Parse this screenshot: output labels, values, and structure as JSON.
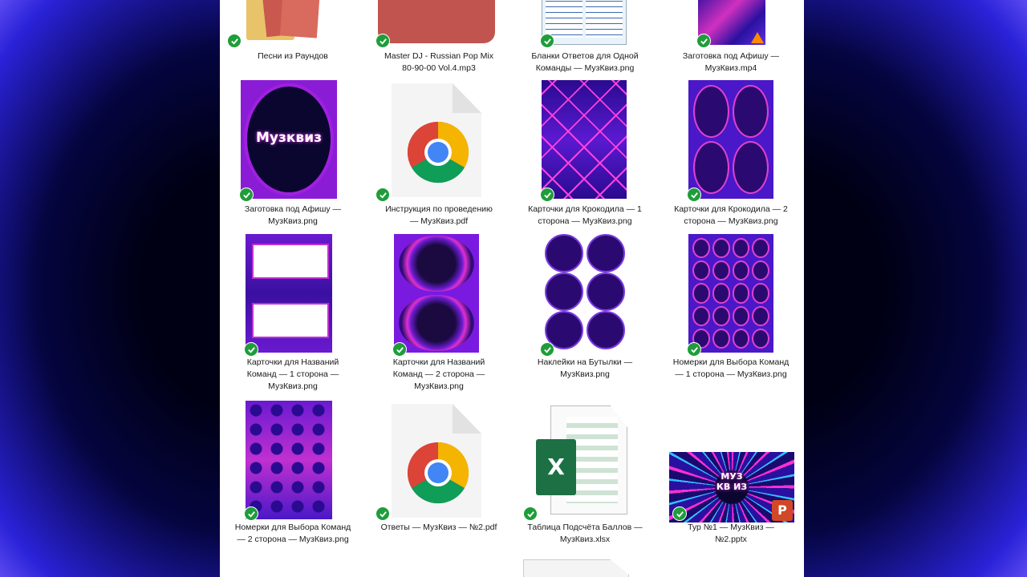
{
  "files": [
    {
      "name": "Песни из Раундов",
      "icon": "folder-icon"
    },
    {
      "name": "Master DJ - Russian Pop Mix\n80-90-00 Vol.4.mp3",
      "icon": "mp3-file-icon"
    },
    {
      "name": "Бланки Ответов для Одной\nКоманды — МузКвиз.png",
      "icon": "image-thumbnail"
    },
    {
      "name": "Заготовка под Афишу —\nМузКвиз.mp4",
      "icon": "video-thumbnail"
    },
    {
      "name": "Заготовка под Афишу —\nМузКвиз.png",
      "icon": "image-thumbnail"
    },
    {
      "name": "Инструкция по проведению\n— МузКвиз.pdf",
      "icon": "chrome-pdf-icon"
    },
    {
      "name": "Карточки для Крокодила — 1\nсторона — МузКвиз.png",
      "icon": "image-thumbnail"
    },
    {
      "name": "Карточки для Крокодила — 2\nсторона — МузКвиз.png",
      "icon": "image-thumbnail"
    },
    {
      "name": "Карточки для Названий\nКоманд — 1 сторона —\nМузКвиз.png",
      "icon": "image-thumbnail"
    },
    {
      "name": "Карточки для Названий\nКоманд — 2 сторона —\nМузКвиз.png",
      "icon": "image-thumbnail"
    },
    {
      "name": "Наклейки на Бутылки —\nМузКвиз.png",
      "icon": "image-thumbnail"
    },
    {
      "name": "Номерки для Выбора Команд\n— 1 сторона — МузКвиз.png",
      "icon": "image-thumbnail"
    },
    {
      "name": "Номерки для Выбора Команд\n— 2 сторона — МузКвиз.png",
      "icon": "image-thumbnail"
    },
    {
      "name": "Ответы — МузКвиз — №2.pdf",
      "icon": "chrome-pdf-icon"
    },
    {
      "name": "Таблица Подсчёта Баллов —\nМузКвиз.xlsx",
      "icon": "excel-icon"
    },
    {
      "name": "Тур №1 — МузКвиз —\n№2.pptx",
      "icon": "powerpoint-thumbnail"
    }
  ],
  "thumb_text": {
    "logo": "Музквиз",
    "logo_short": "МУЗ КВ ИЗ",
    "excel_letter": "X",
    "ppt_letter": "P"
  },
  "colors": {
    "sync_check": "#1f9d3a",
    "panel_bg": "#ffffff",
    "neon_purple": "#6a1cd0",
    "neon_pink": "#e030d0"
  }
}
